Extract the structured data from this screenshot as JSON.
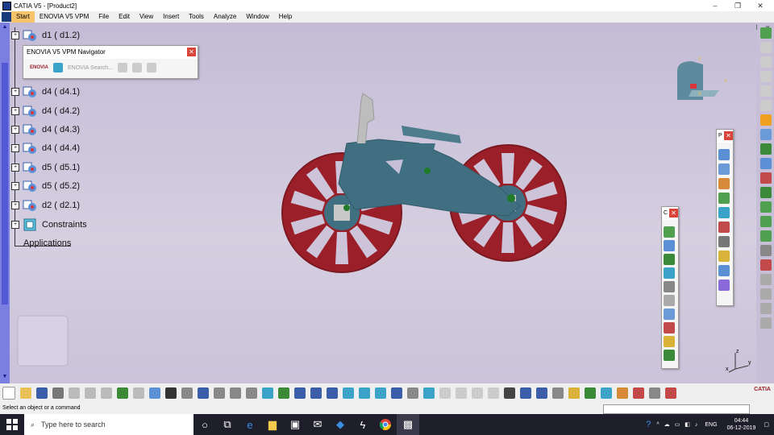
{
  "window": {
    "title": "CATIA V5 - [Product2]",
    "controls": [
      "–",
      "❐",
      "✕"
    ]
  },
  "menubar": {
    "items": [
      "Start",
      "ENOVIA V5 VPM",
      "File",
      "Edit",
      "View",
      "Insert",
      "Tools",
      "Analyze",
      "Window",
      "Help"
    ],
    "doc_controls": [
      "–",
      "❐",
      "✕"
    ]
  },
  "tree": {
    "items": [
      {
        "label": "d1 ( d1.2)"
      },
      {
        "label": "d4 ( d4.1)"
      },
      {
        "label": "d4 ( d4.2)"
      },
      {
        "label": "d4 ( d4.3)"
      },
      {
        "label": "d4 ( d4.4)"
      },
      {
        "label": "d5 ( d5.1)"
      },
      {
        "label": "d5 ( d5.2)"
      },
      {
        "label": "d2 ( d2.1)"
      }
    ],
    "constraints": "Constraints",
    "applications": "Applications"
  },
  "enovia_panel": {
    "title": "ENOVIA V5 VPM Navigator",
    "logo_text": "ENOVIA",
    "search_label": "ENOVIA Search..."
  },
  "float_panel_1": {
    "title": "P"
  },
  "float_panel_2": {
    "title": "C"
  },
  "compass": {
    "x_label": "x",
    "y_label": "y",
    "z_label": "z"
  },
  "axis_triad": {
    "x_label": "x",
    "y_label": "y",
    "z_label": "z"
  },
  "statusbar": {
    "message": "Select an object or a command"
  },
  "taskbar": {
    "search_placeholder": "Type here to search",
    "lang": "ENG",
    "time": "04:44",
    "date": "06-12-2019"
  },
  "catia_logo": "CATIA",
  "colors": {
    "frame": "#3f6f80",
    "wheel": "#9a1f28",
    "hub": "#c8c8c8",
    "background": "#c7bfd8"
  }
}
